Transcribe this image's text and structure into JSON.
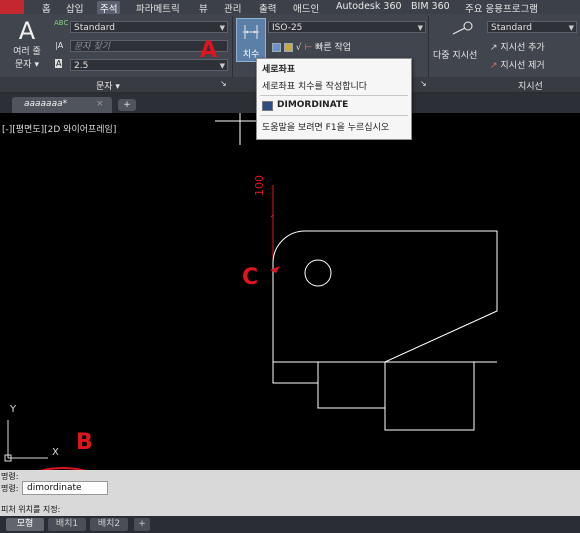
{
  "menu": {
    "items": [
      "홈",
      "삽입",
      "주석",
      "파라메트릭",
      "뷰",
      "관리",
      "출력",
      "애드인",
      "Autodesk 360",
      "BIM 360",
      "주요 응용프로그램"
    ],
    "active": "주석"
  },
  "ribbon": {
    "text_panel": {
      "big_icon_glyph": "A",
      "big_label_1": "여러 줄",
      "big_label_2": "문자",
      "style_value": "Standard",
      "find_placeholder": "문자 찾기",
      "height_value": "2.5",
      "panel_label": "문자"
    },
    "dim_panel": {
      "button_label": "치수",
      "style_value": "ISO-25",
      "quick_label": "빠른 작업"
    },
    "leader_panel": {
      "multi_leader_label": "다중 지시선",
      "style_value": "Standard",
      "add_label": "지시선 추가",
      "remove_label": "지시선 제거",
      "panel_label": "지시선"
    }
  },
  "tooltip": {
    "title": "세로좌표",
    "description": "세로좌표 치수를 작성합니다",
    "command": "DIMORDINATE",
    "help": "도움말을 보려면 F1을 누르십시오"
  },
  "file_tab": {
    "label": "aaaaaaa*",
    "close": "×",
    "add": "+"
  },
  "viewport": {
    "label": "[-][평면도][2D 와이어프레임]",
    "dimension_text": "100",
    "ucs_x": "X",
    "ucs_y": "Y"
  },
  "command": {
    "line1": "명령:",
    "line2_prefix": "명령:",
    "input_value": "dimordinate",
    "prompt": "피처 위치를 지정:"
  },
  "layout_tabs": [
    "모형",
    "배치1",
    "배치2",
    "+"
  ],
  "annotations": {
    "a": "A",
    "b": "B",
    "c": "C"
  },
  "colors": {
    "annotation": "#e0141e",
    "ribbon_bg": "#41454e",
    "drawing_lines": "#ffffff",
    "dim_color": "#e0141e"
  }
}
